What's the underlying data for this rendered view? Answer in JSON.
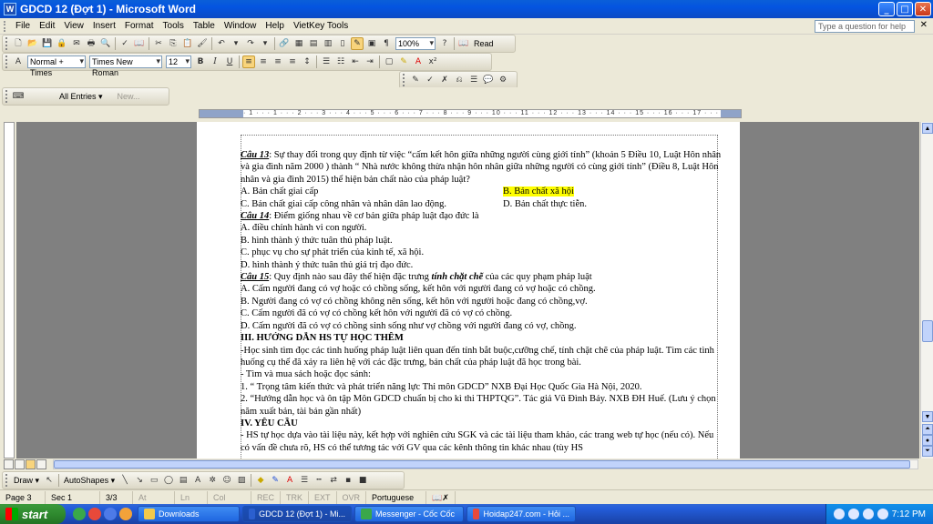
{
  "window": {
    "app_icon": "W",
    "title": "GDCD 12 (Đợt 1) - Microsoft Word",
    "controls": {
      "minimize": "_",
      "maximize": "□",
      "close": "✕"
    }
  },
  "menubar": {
    "items": [
      "File",
      "Edit",
      "View",
      "Insert",
      "Format",
      "Tools",
      "Table",
      "Window",
      "Help",
      "VietKey Tools"
    ],
    "help_placeholder": "Type a question for help",
    "help_close": "✕"
  },
  "standard_toolbar": {
    "zoom": "100%",
    "read_label": "Read"
  },
  "formatting_toolbar": {
    "style": "Normal + Times",
    "font": "Times New Roman",
    "size": "12",
    "bold": "B",
    "italic": "I",
    "underline": "U"
  },
  "autotext_toolbar": {
    "all_entries": "All Entries ▾",
    "new_label": "New..."
  },
  "ruler": {
    "ticks": "· 1 · · · 1 · · · 2 · · · 3 · · · 4 · · · 5 · · · 6 · · · 7 · · · 8 · · · 9 · · · 10 · · · 11 · · · 12 · · · 13 · · · 14 · · · 15 · · · 16 · · · 17 · · · 18 · 19"
  },
  "document": {
    "q13": {
      "label": "Câu 13",
      "text": ": Sự thay đổi trong quy định từ việc “cấm kết hôn giữa những người cùng giới tính” (khoản 5 Điều 10, Luật Hôn nhân và gia đình năm 2000 ) thành “ Nhà nước không thừa nhận hôn nhân giữa những người có cùng giới tính” (Điều 8, Luật Hôn nhân và gia đình 2015) thể hiện  bản chất nào của pháp luật?",
      "a": "A. Bản chất giai cấp",
      "b": "B. Bản chất xã hội",
      "c": "C. Bản chất giai cấp công nhân và nhân dân lao động.",
      "d": "D. Bản chất thực tiễn."
    },
    "q14": {
      "label": "Câu 14",
      "text": ": Điểm giống nhau về cơ bản giữa pháp luật đạo đức là",
      "a": "A. điều chỉnh hành vi con người.",
      "b": "B. hình thành ý thức tuân thủ pháp luật.",
      "c": "C. phục vụ cho sự phát triển của kinh tế, xã hội.",
      "d": "D. hình thành ý thức tuân thủ giá trị đạo đức."
    },
    "q15": {
      "label": "Câu 15",
      "text_before": ": Quy định nào sau đây thể hiện đặc trưng ",
      "emphasis": "tính chặt chẽ",
      "text_after": " của các quy phạm pháp luật",
      "a": "A. Cấm người đang có vợ hoặc có chồng sống, kết hôn với người đang có vợ hoặc có chồng.",
      "b": "B. Người đang có vợ có chồng không nên sống, kết hôn với người hoặc đang có chồng,vợ.",
      "c": "C. Cấm người đã có vợ có chồng kết hôn với người đã có vợ có chồng.",
      "d": "D. Cấm người đã có vợ có chồng sinh sống như vợ chồng với người đang có vợ, chồng."
    },
    "section3": {
      "heading": "III. HƯỚNG DẪN HS TỰ HỌC THÊM",
      "p1": "-Học sinh tìm đọc các tình huống pháp luật liên quan đến tính bắt buộc,cưỡng chế, tính chặt chẽ của pháp luật. Tìm các tình huống cụ thể đã xảy ra liên hệ với các đặc trưng, bản chất của pháp luật đã học trong bài.",
      "p2": "- Tìm và mua sách hoặc đọc sánh:",
      "p3": "1. “ Trọng tâm kiến thức và phát triển năng lực Thi môn GDCD”  NXB Đại Học Quốc Gia Hà Nội, 2020.",
      "p4": "2. “Hướng dẫn học và ôn tập Môn GDCD chuẩn bị cho kì thi THPTQG”. Tác giả Vũ Đình Bảy. NXB  ĐH Huế. (Lưu ý chọn năm xuất bản, tài bản gần nhất)"
    },
    "section4": {
      "heading": "IV. YÊU CẦU",
      "p1": "- HS tự học dựa vào tài liệu này, kết hợp với nghiên cứu SGK và các tài liệu tham khảo, các trang web tự học (nếu có). Nếu có vấn đề chưa rõ, HS có thể tương tác với GV qua các kênh thông tin khác nhau (tùy HS"
    }
  },
  "drawing_toolbar": {
    "draw": "Draw ▾",
    "autoshapes": "AutoShapes ▾"
  },
  "statusbar": {
    "page": "Page 3",
    "sec": "Sec 1",
    "pages": "3/3",
    "at": "At",
    "ln": "Ln",
    "col": "Col",
    "rec": "REC",
    "trk": "TRK",
    "ext": "EXT",
    "ovr": "OVR",
    "language": "Portuguese"
  },
  "taskbar": {
    "start": "start",
    "tasks": [
      "Downloads",
      "GDCD 12 (Đợt 1) - Mi...",
      "Messenger - Cốc Cốc",
      "Hoidap247.com - Hỏi ..."
    ],
    "clock": "7:12 PM"
  }
}
